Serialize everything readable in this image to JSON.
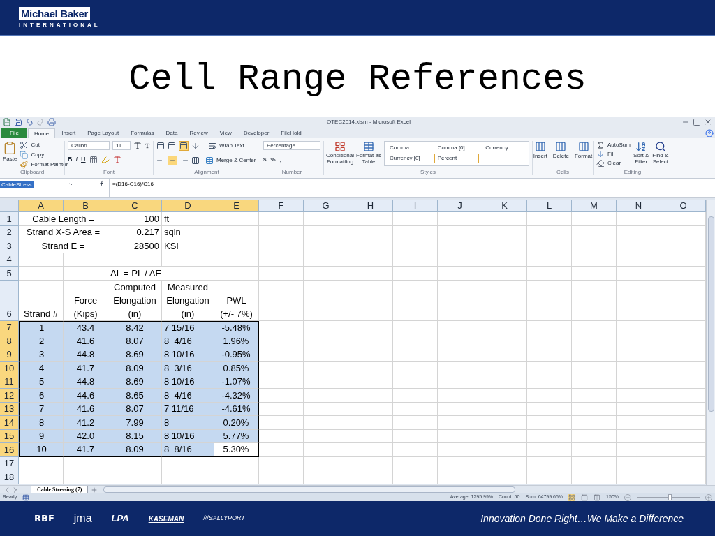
{
  "header": {
    "logo_name": "Michael Baker",
    "logo_sub": "INTERNATIONAL"
  },
  "slide_title": "Cell Range References",
  "excel": {
    "title": "OTEC2014.xlsm - Microsoft Excel",
    "tabs": [
      {
        "label": "File",
        "kind": "file",
        "selected": false
      },
      {
        "label": "Home",
        "kind": "tab",
        "selected": true
      },
      {
        "label": "Insert",
        "kind": "tab",
        "selected": false
      },
      {
        "label": "Page Layout",
        "kind": "tab",
        "selected": false
      },
      {
        "label": "Formulas",
        "kind": "tab",
        "selected": false
      },
      {
        "label": "Data",
        "kind": "tab",
        "selected": false
      },
      {
        "label": "Review",
        "kind": "tab",
        "selected": false
      },
      {
        "label": "View",
        "kind": "tab",
        "selected": false
      },
      {
        "label": "Developer",
        "kind": "tab",
        "selected": false
      },
      {
        "label": "FileHold",
        "kind": "tab",
        "selected": false
      }
    ],
    "ribbon": {
      "clipboard": {
        "label": "Clipboard",
        "paste": "Paste",
        "cut": "Cut",
        "copy": "Copy",
        "format_painter": "Format Painter"
      },
      "font": {
        "label": "Font",
        "family": "Calibri",
        "size": "11",
        "styles": [
          "B",
          "I",
          "U"
        ]
      },
      "alignment": {
        "label": "Alignment",
        "wrap": "Wrap Text",
        "merge": "Merge & Center"
      },
      "number": {
        "label": "Number",
        "format": "Percentage",
        "symbols": [
          "$",
          "%",
          ","
        ]
      },
      "styles": {
        "label": "Styles",
        "conditional": "Conditional Formatting",
        "format_table": "Format as Table",
        "gallery": [
          {
            "label": "Comma",
            "selected": false
          },
          {
            "label": "Comma [0]",
            "selected": false
          },
          {
            "label": "Currency",
            "selected": false
          },
          {
            "label": "Currency [0]",
            "selected": false
          },
          {
            "label": "Percent",
            "selected": true
          }
        ]
      },
      "cells": {
        "label": "Cells",
        "buttons": [
          "Insert",
          "Delete",
          "Format"
        ]
      },
      "editing": {
        "label": "Editing",
        "autosum": "AutoSum",
        "fill": "Fill",
        "clear": "Clear",
        "sort": "Sort & Filter",
        "find": "Find & Select"
      }
    },
    "name_box": "CableStress",
    "formula": "=(D16-C16)/C16",
    "columns": [
      {
        "label": "A",
        "selected": true
      },
      {
        "label": "B",
        "selected": true
      },
      {
        "label": "C",
        "selected": true
      },
      {
        "label": "D",
        "selected": true
      },
      {
        "label": "E",
        "selected": true
      },
      {
        "label": "F",
        "selected": false
      },
      {
        "label": "G",
        "selected": false
      },
      {
        "label": "H",
        "selected": false
      },
      {
        "label": "I",
        "selected": false
      },
      {
        "label": "J",
        "selected": false
      },
      {
        "label": "K",
        "selected": false
      },
      {
        "label": "L",
        "selected": false
      },
      {
        "label": "M",
        "selected": false
      },
      {
        "label": "N",
        "selected": false
      },
      {
        "label": "O",
        "selected": false
      }
    ],
    "rows": [
      {
        "number": "1",
        "kind": "input",
        "selected": false,
        "cells": [
          "Cable Length =",
          "",
          "100",
          "ft"
        ]
      },
      {
        "number": "2",
        "kind": "input",
        "selected": false,
        "cells": [
          "Strand X-S Area =",
          "",
          "0.217",
          "sqin"
        ]
      },
      {
        "number": "3",
        "kind": "input",
        "selected": false,
        "cells": [
          "Strand E =",
          "",
          "28500",
          "KSI"
        ]
      },
      {
        "number": "4",
        "kind": "blank",
        "selected": false
      },
      {
        "number": "5",
        "kind": "note",
        "selected": false,
        "cells": [
          "",
          "",
          "ΔL = PL / AE"
        ]
      },
      {
        "number": "6",
        "kind": "header",
        "selected": false,
        "cells": [
          "Strand #",
          "Force (Kips)",
          "Computed Elongation (in)",
          "Measured Elongation (in)",
          "PWL (+/- 7%)"
        ]
      },
      {
        "number": "7",
        "kind": "data",
        "selected": true,
        "cells": [
          {
            "text": "1",
            "selected": true
          },
          {
            "text": "43.4",
            "selected": true
          },
          {
            "text": "8.42",
            "selected": true
          },
          {
            "text": "7 15/16",
            "selected": true
          },
          {
            "text": "-5.48%",
            "selected": true
          }
        ]
      },
      {
        "number": "8",
        "kind": "data",
        "selected": true,
        "cells": [
          {
            "text": "2",
            "selected": true
          },
          {
            "text": "41.6",
            "selected": true
          },
          {
            "text": "8.07",
            "selected": true
          },
          {
            "text": "8  4/16",
            "selected": true
          },
          {
            "text": "1.96%",
            "selected": true
          }
        ]
      },
      {
        "number": "9",
        "kind": "data",
        "selected": true,
        "cells": [
          {
            "text": "3",
            "selected": true
          },
          {
            "text": "44.8",
            "selected": true
          },
          {
            "text": "8.69",
            "selected": true
          },
          {
            "text": "8 10/16",
            "selected": true
          },
          {
            "text": "-0.95%",
            "selected": true
          }
        ]
      },
      {
        "number": "10",
        "kind": "data",
        "selected": true,
        "cells": [
          {
            "text": "4",
            "selected": true
          },
          {
            "text": "41.7",
            "selected": true
          },
          {
            "text": "8.09",
            "selected": true
          },
          {
            "text": "8  3/16",
            "selected": true
          },
          {
            "text": "0.85%",
            "selected": true
          }
        ]
      },
      {
        "number": "11",
        "kind": "data",
        "selected": true,
        "cells": [
          {
            "text": "5",
            "selected": true
          },
          {
            "text": "44.8",
            "selected": true
          },
          {
            "text": "8.69",
            "selected": true
          },
          {
            "text": "8 10/16",
            "selected": true
          },
          {
            "text": "-1.07%",
            "selected": true
          }
        ]
      },
      {
        "number": "12",
        "kind": "data",
        "selected": true,
        "cells": [
          {
            "text": "6",
            "selected": true
          },
          {
            "text": "44.6",
            "selected": true
          },
          {
            "text": "8.65",
            "selected": true
          },
          {
            "text": "8  4/16",
            "selected": true
          },
          {
            "text": "-4.32%",
            "selected": true
          }
        ]
      },
      {
        "number": "13",
        "kind": "data",
        "selected": true,
        "cells": [
          {
            "text": "7",
            "selected": true
          },
          {
            "text": "41.6",
            "selected": true
          },
          {
            "text": "8.07",
            "selected": true
          },
          {
            "text": "7 11/16",
            "selected": true
          },
          {
            "text": "-4.61%",
            "selected": true
          }
        ]
      },
      {
        "number": "14",
        "kind": "data",
        "selected": true,
        "cells": [
          {
            "text": "8",
            "selected": true
          },
          {
            "text": "41.2",
            "selected": true
          },
          {
            "text": "7.99",
            "selected": true
          },
          {
            "text": "8",
            "selected": true
          },
          {
            "text": "0.20%",
            "selected": true
          }
        ]
      },
      {
        "number": "15",
        "kind": "data",
        "selected": true,
        "cells": [
          {
            "text": "9",
            "selected": true
          },
          {
            "text": "42.0",
            "selected": true
          },
          {
            "text": "8.15",
            "selected": true
          },
          {
            "text": "8 10/16",
            "selected": true
          },
          {
            "text": "5.77%",
            "selected": true
          }
        ]
      },
      {
        "number": "16",
        "kind": "data",
        "selected": true,
        "cells": [
          {
            "text": "10",
            "selected": true
          },
          {
            "text": "41.7",
            "selected": true
          },
          {
            "text": "8.09",
            "selected": true
          },
          {
            "text": "8  8/16",
            "selected": true
          },
          {
            "text": "5.30%",
            "selected": false
          }
        ]
      },
      {
        "number": "17",
        "kind": "blank",
        "selected": false
      },
      {
        "number": "18",
        "kind": "blank",
        "selected": false
      }
    ],
    "sheet_tab": "Cable Stressing (7)",
    "status": {
      "ready": "Ready",
      "average": "Average: 1295.99%",
      "count": "Count: 50",
      "sum": "Sum: 64799.65%",
      "zoom": "150%",
      "zoom_slider": {
        "level": 0.52
      }
    }
  },
  "footer": {
    "partners": [
      {
        "kind": "rbf",
        "text": "RBF"
      },
      {
        "kind": "jma",
        "text": "jma"
      },
      {
        "kind": "lpa",
        "text": "LPA"
      },
      {
        "kind": "kaseman",
        "text": "KASEMAN"
      },
      {
        "kind": "sallyport",
        "text": "///SALLYPORT"
      }
    ],
    "tagline": "Innovation Done Right…We Make a Difference"
  }
}
